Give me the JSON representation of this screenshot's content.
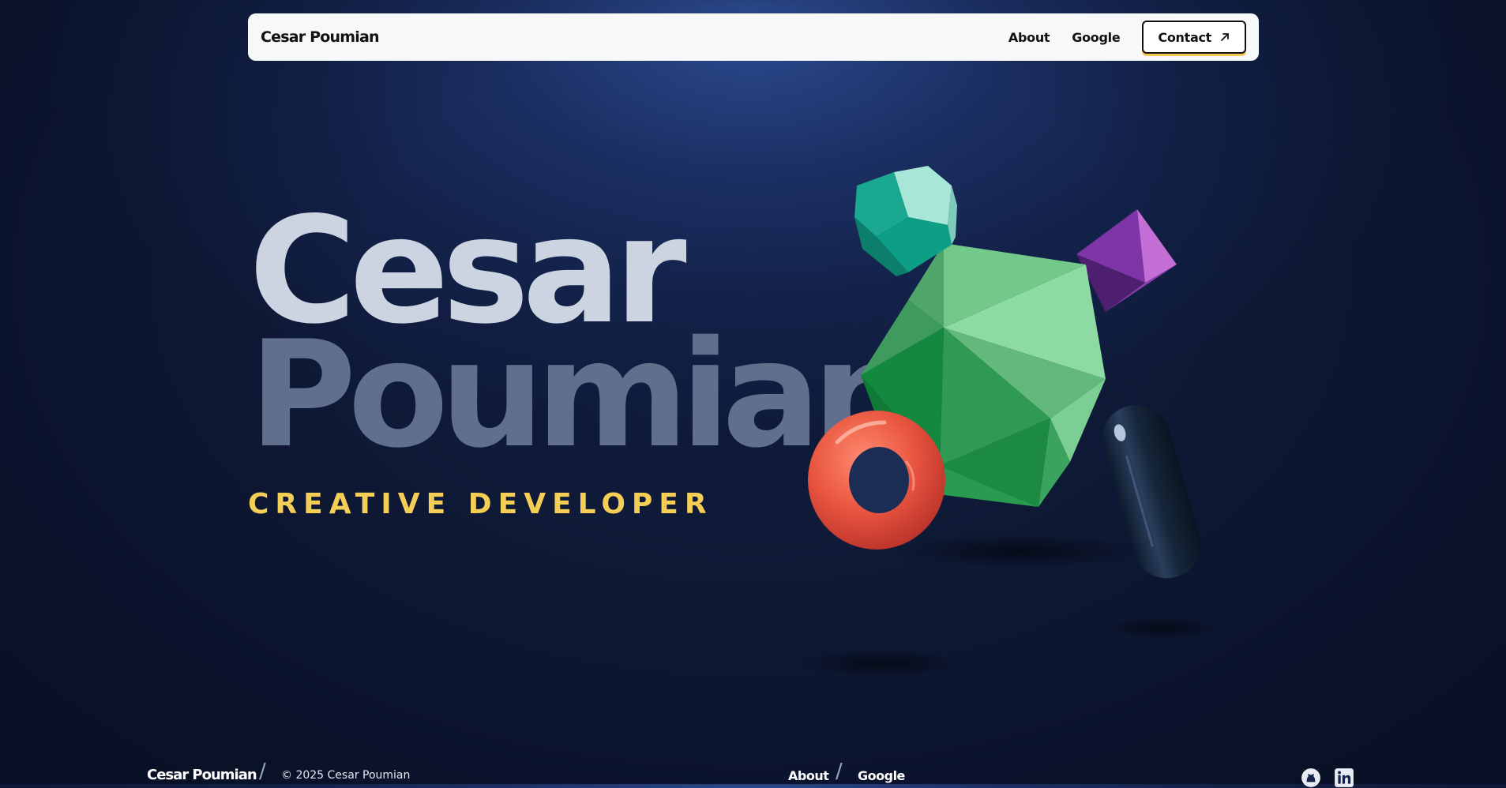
{
  "nav": {
    "brand": "Cesar Poumian",
    "links": [
      "About",
      "Google"
    ],
    "contact_label": "Contact"
  },
  "hero": {
    "first_name": "Cesar",
    "last_name": "Poumian",
    "subtitle": "CREATIVE DEVELOPER"
  },
  "footer": {
    "brand": "Cesar Poumian",
    "copyright": "© 2025 Cesar Poumian",
    "links": [
      "About",
      "Google"
    ],
    "social_icons": [
      "github-icon",
      "linkedin-icon"
    ]
  },
  "colors": {
    "background": "#13224a",
    "first_name": "#ccd4e2",
    "last_name": "#5f6f8c",
    "accent": "#f5cf55",
    "nav_bg": "#f7f8fa"
  }
}
